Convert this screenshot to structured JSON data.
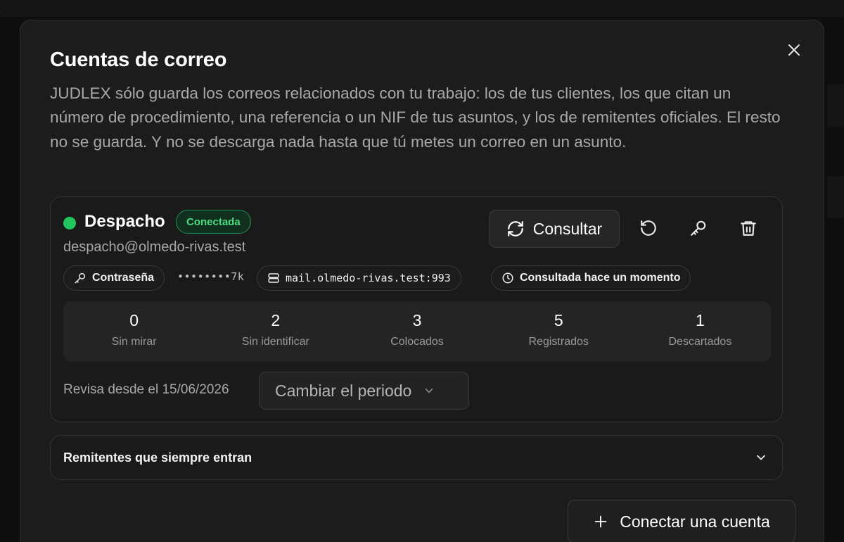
{
  "modal": {
    "title": "Cuentas de correo",
    "intro": "JUDLEX sólo guarda los correos relacionados con tu trabajo: los de tus clientes, los que citan un número de procedimiento, una referencia o un NIF de tus asuntos, y los de remitentes oficiales. El resto no se guarda. Y no se descarga nada hasta que tú metes un correo en un asunto.",
    "close_icon": "close-icon"
  },
  "account": {
    "name": "Despacho",
    "status_badge": "Conectada",
    "status_color": "#22c55e",
    "email": "despacho@olmedo-rivas.test",
    "consult_label": "Consultar",
    "password_chip": "Contraseña",
    "password_mask": "••••••••7k",
    "server": "mail.olmedo-rivas.test:993",
    "last_checked": "Consultada hace un momento",
    "stats": [
      {
        "value": "0",
        "label": "Sin mirar"
      },
      {
        "value": "2",
        "label": "Sin identificar"
      },
      {
        "value": "3",
        "label": "Colocados"
      },
      {
        "value": "5",
        "label": "Registrados"
      },
      {
        "value": "1",
        "label": "Descartados"
      }
    ],
    "since_text": "Revisa desde el 15/06/2026",
    "period_select": "Cambiar el periodo"
  },
  "senders": {
    "label": "Remitentes que siempre entran"
  },
  "connect_button": "Conectar una cuenta"
}
